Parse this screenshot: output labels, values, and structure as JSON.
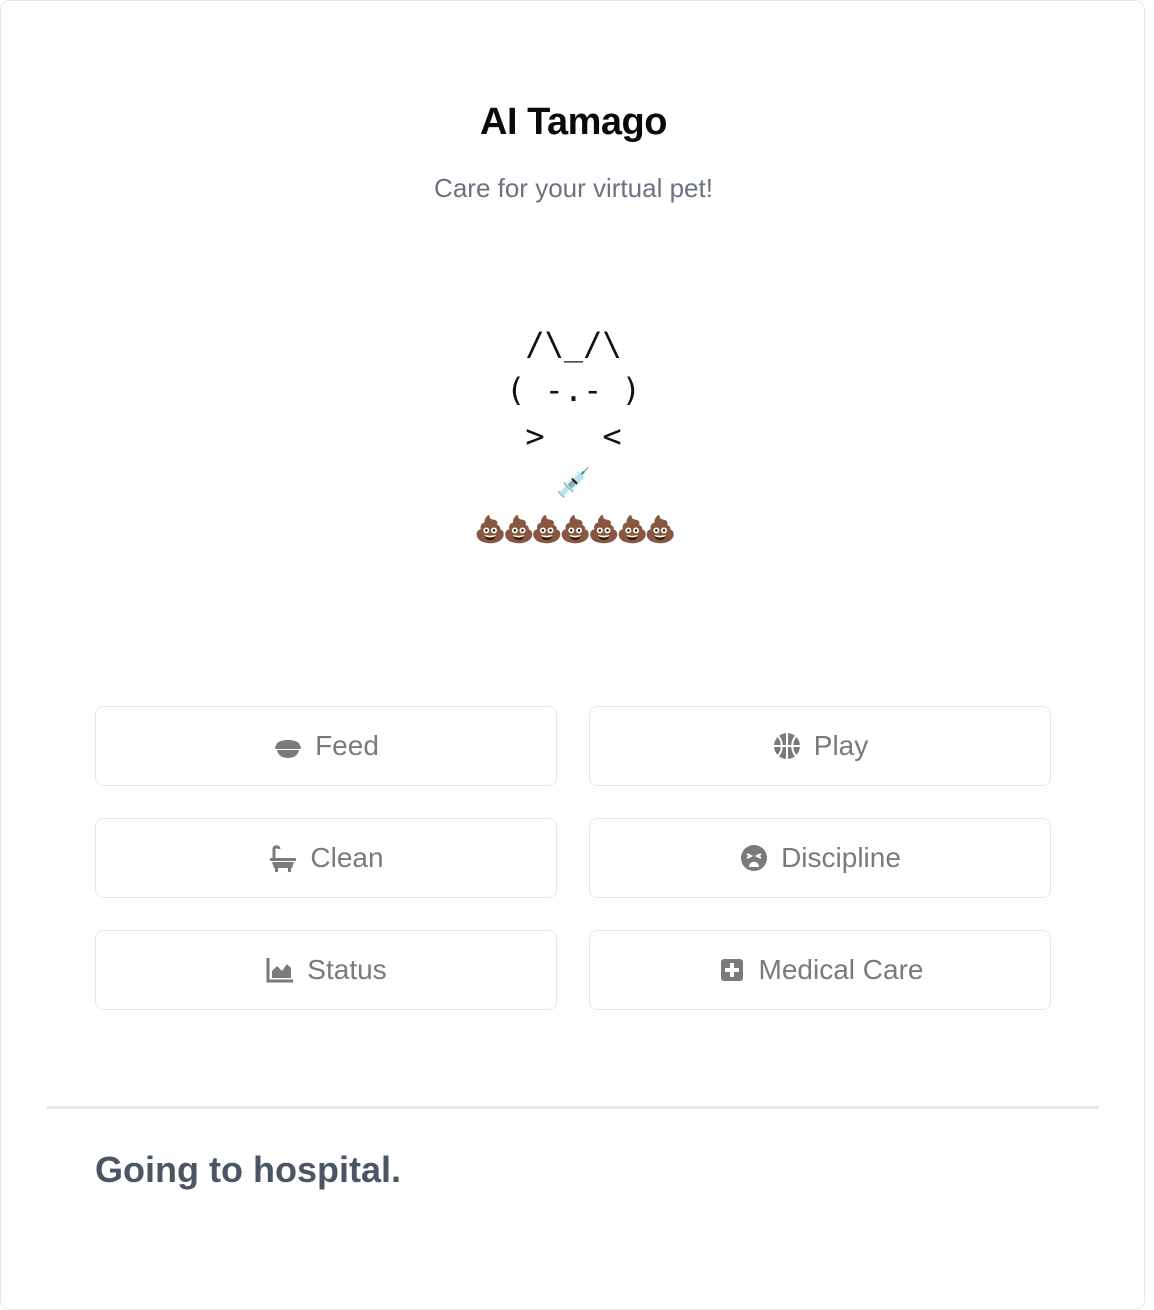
{
  "header": {
    "title": "AI Tamago",
    "subtitle": "Care for your virtual pet!"
  },
  "pet": {
    "ascii_lines": [
      " /\\_/\\ ",
      "( -.- )",
      " >   < "
    ],
    "medical_indicator": "💉",
    "poop_indicator": "💩💩💩💩💩💩💩"
  },
  "actions": {
    "feed": {
      "label": "Feed",
      "icon": "bowl-food-icon"
    },
    "play": {
      "label": "Play",
      "icon": "basketball-icon"
    },
    "clean": {
      "label": "Clean",
      "icon": "bath-icon"
    },
    "discipline": {
      "label": "Discipline",
      "icon": "face-tired-icon"
    },
    "status": {
      "label": "Status",
      "icon": "chart-area-icon"
    },
    "medical": {
      "label": "Medical Care",
      "icon": "medical-kit-icon"
    }
  },
  "status_message": "Going to hospital.",
  "colors": {
    "button_text": "#7a7a7a",
    "subtitle": "#6b7280",
    "message": "#4b5563",
    "border": "#e5e7eb"
  }
}
